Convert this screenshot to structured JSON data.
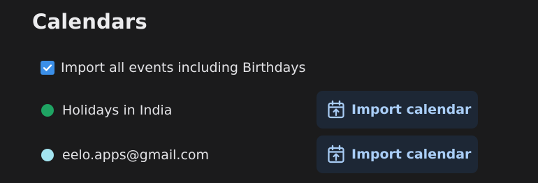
{
  "section": {
    "title": "Calendars"
  },
  "import_all": {
    "checked": true,
    "label": "Import all events including Birthdays",
    "color": "#3b8fe8"
  },
  "calendars": [
    {
      "name": "Holidays in India",
      "dot_color": "#1fa463",
      "button_label": "Import calendar",
      "button_icon": "calendar-import-icon"
    },
    {
      "name": "eelo.apps@gmail.com",
      "dot_color": "#a3e4f0",
      "button_label": "Import calendar",
      "button_icon": "calendar-import-icon"
    }
  ],
  "colors": {
    "background": "#1b1b1c",
    "button_bg": "#1d2735",
    "button_text": "#a9cdf6"
  }
}
